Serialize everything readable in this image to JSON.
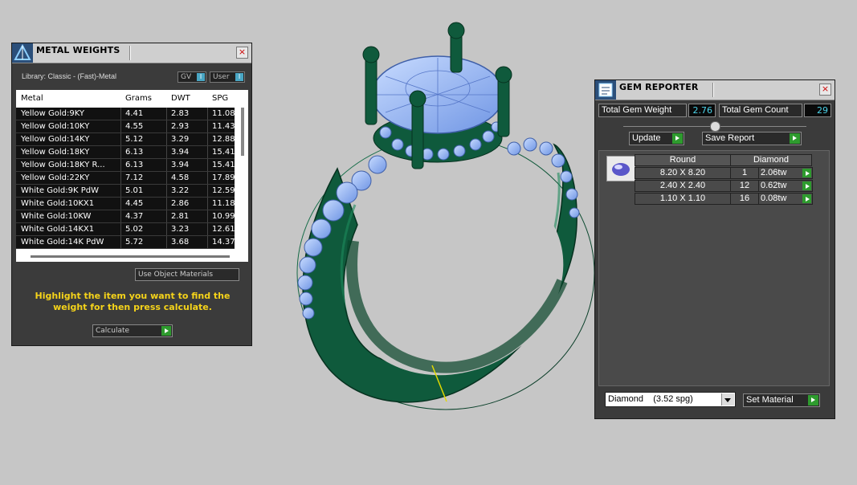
{
  "metal_panel": {
    "title": "METAL WEIGHTS",
    "close": "×",
    "library": "Library: Classic - (Fast)-Metal",
    "toggle_gv": "GV",
    "toggle_user": "User",
    "columns": [
      "Metal",
      "Grams",
      "DWT",
      "SPG"
    ],
    "rows": [
      {
        "metal": "Yellow Gold:9KY",
        "grams": "4.41",
        "dwt": "2.83",
        "spg": "11.08"
      },
      {
        "metal": "Yellow Gold:10KY",
        "grams": "4.55",
        "dwt": "2.93",
        "spg": "11.43"
      },
      {
        "metal": "Yellow Gold:14KY",
        "grams": "5.12",
        "dwt": "3.29",
        "spg": "12.88"
      },
      {
        "metal": "Yellow Gold:18KY",
        "grams": "6.13",
        "dwt": "3.94",
        "spg": "15.41"
      },
      {
        "metal": "Yellow Gold:18KY R...",
        "grams": "6.13",
        "dwt": "3.94",
        "spg": "15.41"
      },
      {
        "metal": "Yellow Gold:22KY",
        "grams": "7.12",
        "dwt": "4.58",
        "spg": "17.89"
      },
      {
        "metal": "White Gold:9K PdW",
        "grams": "5.01",
        "dwt": "3.22",
        "spg": "12.59"
      },
      {
        "metal": "White Gold:10KX1",
        "grams": "4.45",
        "dwt": "2.86",
        "spg": "11.18"
      },
      {
        "metal": "White Gold:10KW",
        "grams": "4.37",
        "dwt": "2.81",
        "spg": "10.99"
      },
      {
        "metal": "White Gold:14KX1",
        "grams": "5.02",
        "dwt": "3.23",
        "spg": "12.61"
      },
      {
        "metal": "White Gold:14K PdW",
        "grams": "5.72",
        "dwt": "3.68",
        "spg": "14.37"
      }
    ],
    "use_object_materials": "Use Object Materials",
    "hint": "Highlight the item you want to find the weight for then press calculate.",
    "calculate": "Calculate"
  },
  "gem_panel": {
    "title": "GEM REPORTER",
    "close": "×",
    "total_weight_label": "Total Gem Weight",
    "total_weight_value": "2.76",
    "total_count_label": "Total Gem Count",
    "total_count_value": "29",
    "update": "Update",
    "save_report": "Save Report",
    "shape": "Round",
    "material": "Diamond",
    "gems": [
      {
        "size": "8.20 X 8.20",
        "count": "1",
        "weight": "2.06tw"
      },
      {
        "size": "2.40 X 2.40",
        "count": "12",
        "weight": "0.62tw"
      },
      {
        "size": "1.10 X 1.10",
        "count": "16",
        "weight": "0.08tw"
      }
    ],
    "material_select": "Diamond    (3.52 spg)",
    "set_material": "Set Material"
  },
  "colors": {
    "ring_metal": "#0f5a3c",
    "gem_blue": "#8ab0ee",
    "hint_yellow": "#f5d31a",
    "value_cyan": "#4bd2e8",
    "go_green": "#2e9b2e"
  }
}
